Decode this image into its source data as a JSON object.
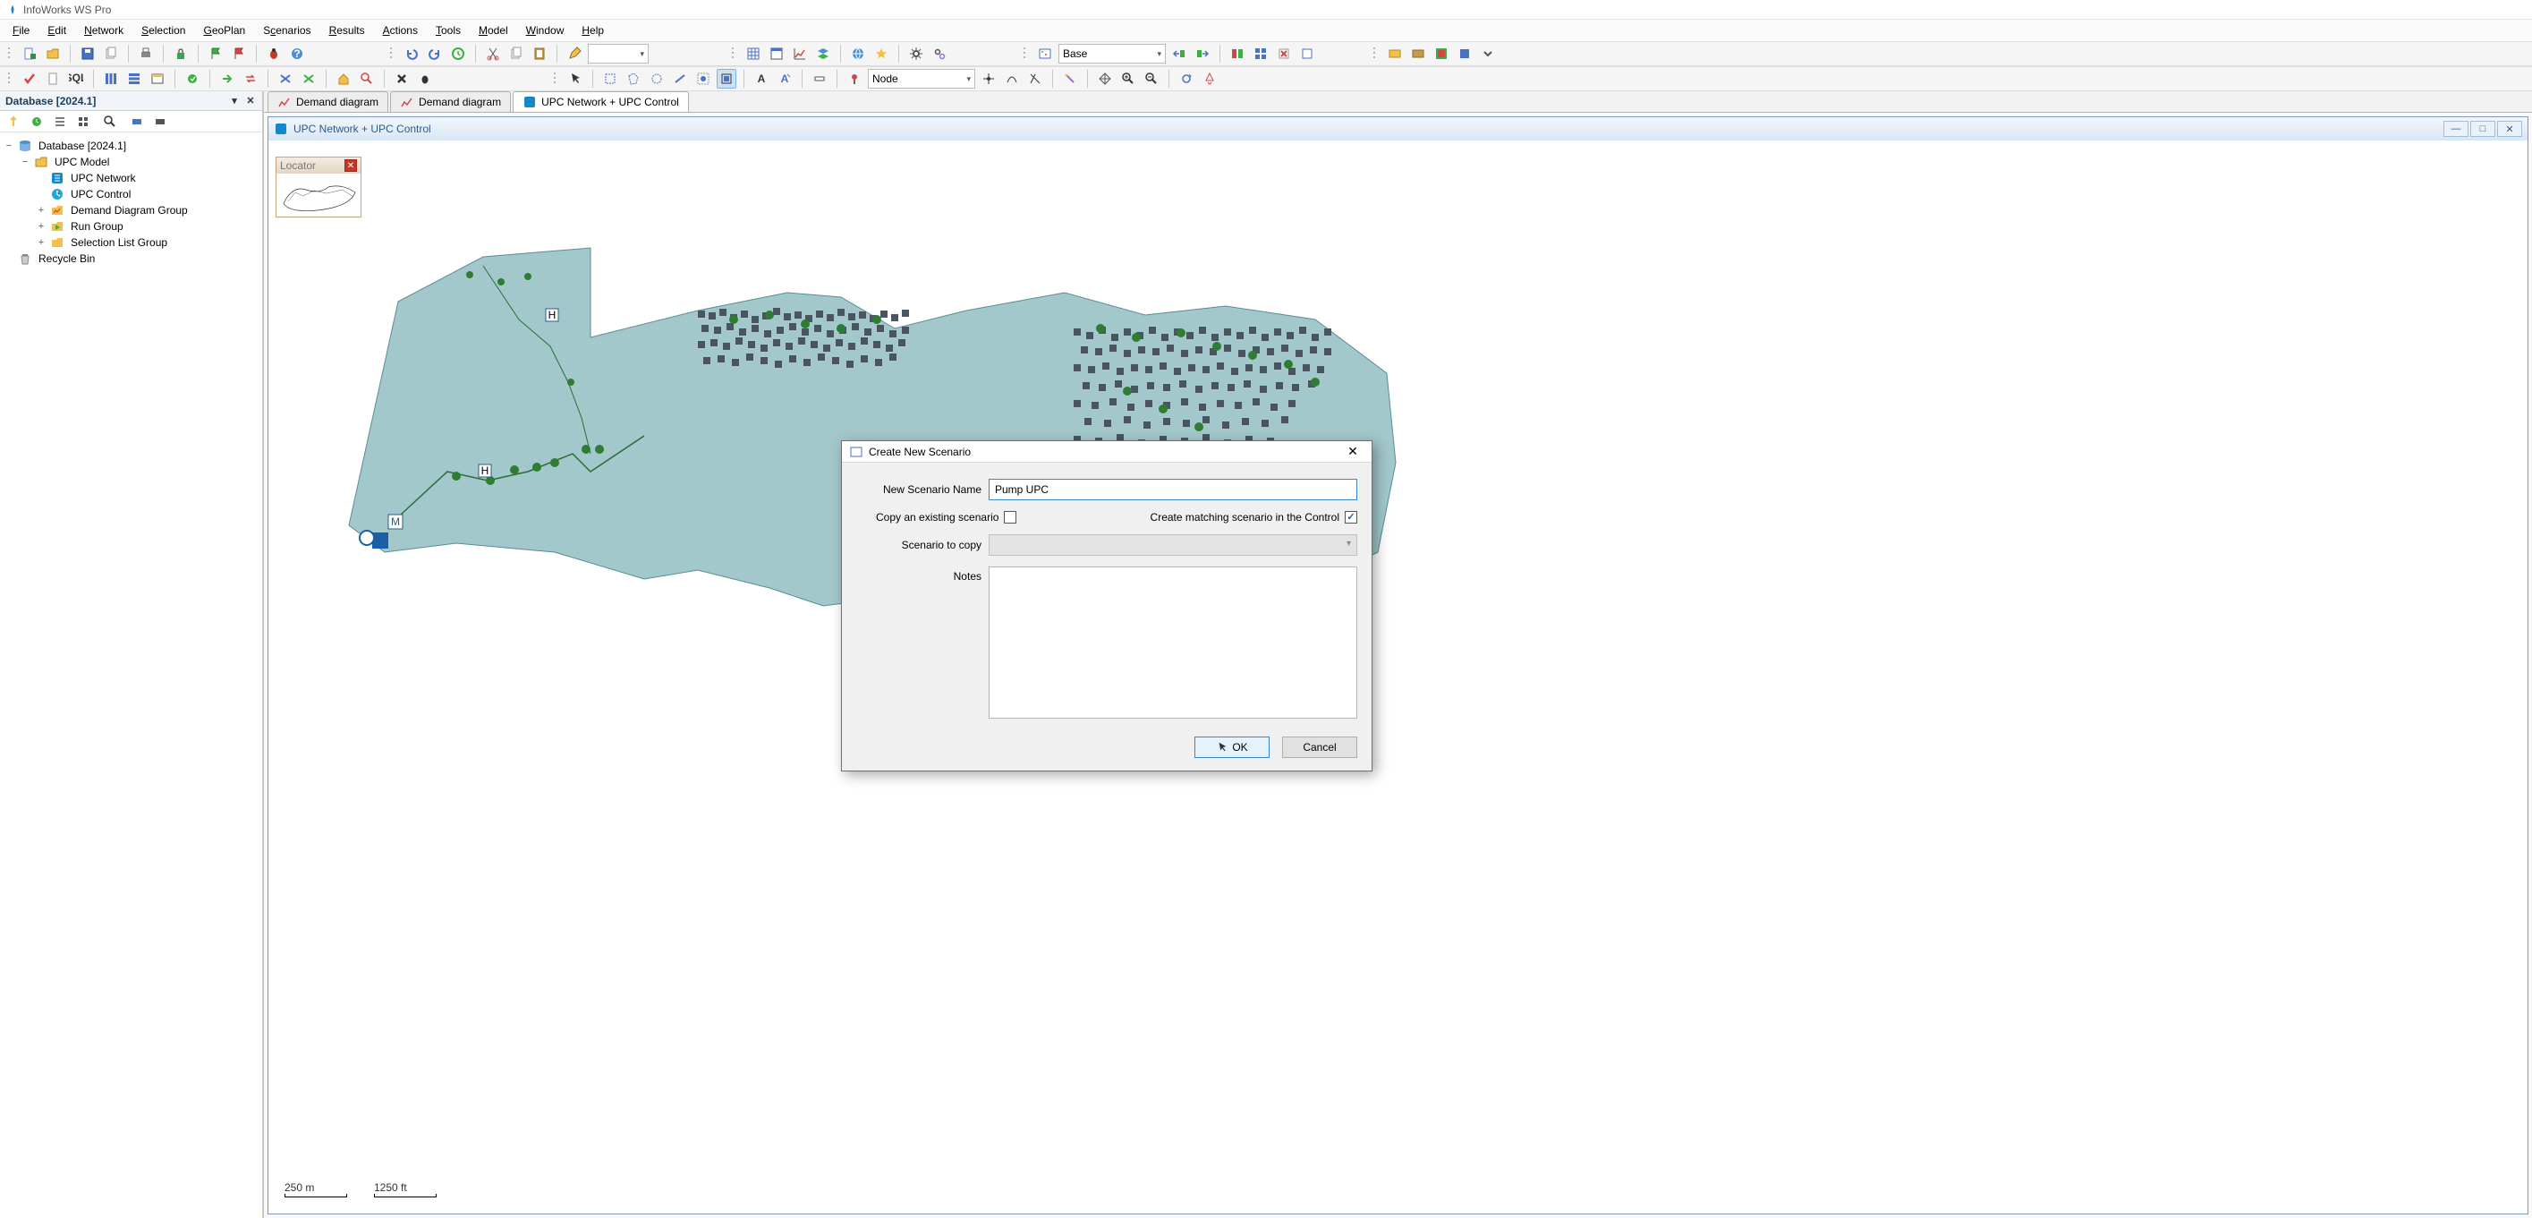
{
  "app_title": "InfoWorks WS Pro",
  "menubar": [
    "File",
    "Edit",
    "Network",
    "Selection",
    "GeoPlan",
    "Scenarios",
    "Results",
    "Actions",
    "Tools",
    "Model",
    "Window",
    "Help"
  ],
  "scenario_selector": "Base",
  "node_selector": "Node",
  "left_panel": {
    "title": "Database [2024.1]",
    "root": "Database [2024.1]",
    "model_group": "UPC Model",
    "network": "UPC Network",
    "control": "UPC Control",
    "demand_group": "Demand Diagram Group",
    "run_group": "Run Group",
    "sel_group": "Selection List Group",
    "recycle": "Recycle Bin"
  },
  "doctabs": [
    {
      "label": "Demand diagram",
      "active": false,
      "icon": "chart"
    },
    {
      "label": "Demand diagram",
      "active": false,
      "icon": "chart"
    },
    {
      "label": "UPC Network + UPC Control",
      "active": true,
      "icon": "net"
    }
  ],
  "mdi_title": "UPC Network + UPC Control",
  "locator_title": "Locator",
  "scale": {
    "metric": "250 m",
    "imperial": "1250 ft"
  },
  "dialog": {
    "title": "Create New Scenario",
    "name_label": "New Scenario Name",
    "name_value": "Pump UPC",
    "copy_label": "Copy an existing scenario",
    "copy_checked": false,
    "match_label": "Create matching scenario in the Control",
    "match_checked": true,
    "copy_src_label": "Scenario to copy",
    "notes_label": "Notes",
    "notes_value": "",
    "ok": "OK",
    "cancel": "Cancel"
  }
}
